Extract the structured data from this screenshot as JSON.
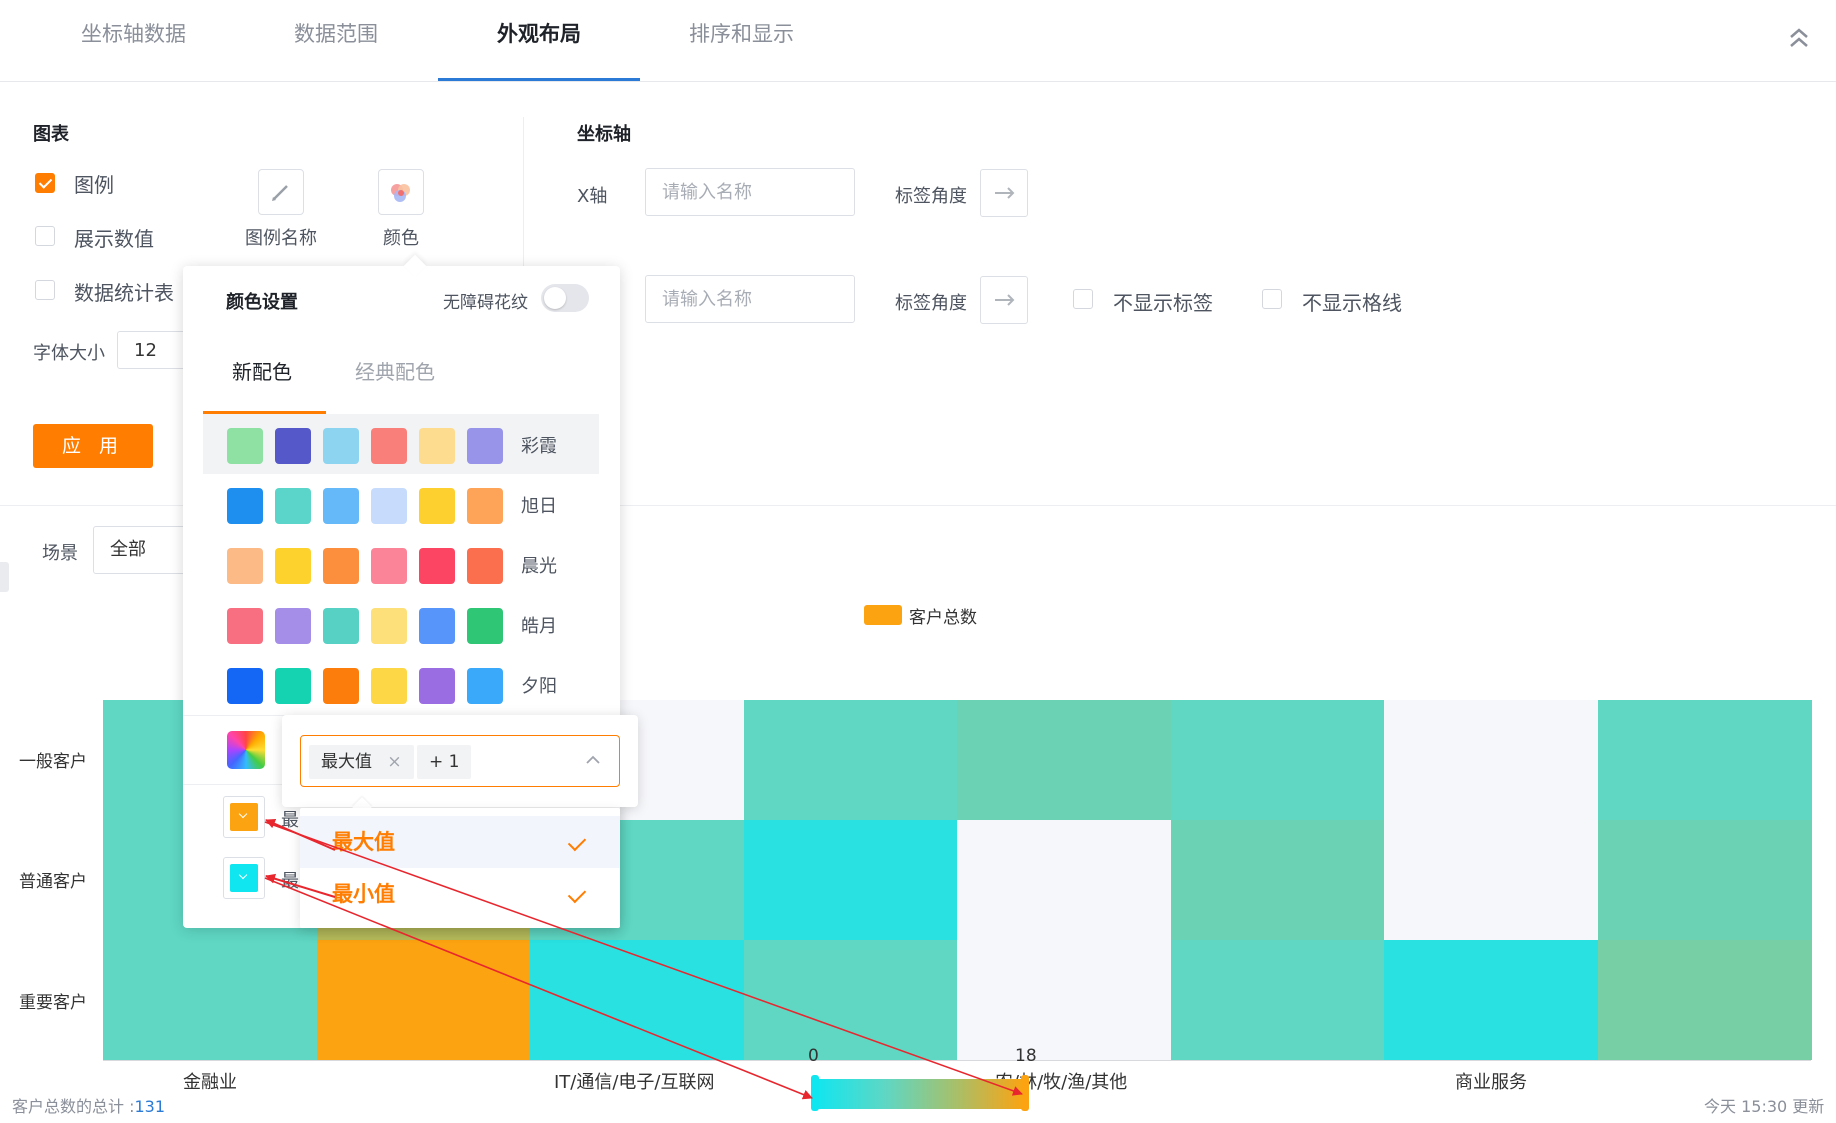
{
  "tabs": [
    {
      "label": "坐标轴数据"
    },
    {
      "label": "数据范围"
    },
    {
      "label": "外观布局"
    },
    {
      "label": "排序和显示"
    }
  ],
  "chart_settings": {
    "title": "图表",
    "legend_label": "图例",
    "show_values_label": "展示数值",
    "stats_table_label": "数据统计表",
    "legend_name_label": "图例名称",
    "color_label": "颜色",
    "font_size_label": "字体大小",
    "font_size_value": "12",
    "apply_label": "应 用"
  },
  "axis_settings": {
    "title": "坐标轴",
    "x_axis_label": "X轴",
    "name_placeholder": "请输入名称",
    "label_angle": "标签角度",
    "hide_labels": "不显示标签",
    "hide_grid": "不显示格线"
  },
  "filter": {
    "scene_label": "场景",
    "scene_value": "全部"
  },
  "color_popover": {
    "title": "颜色设置",
    "accessible_label": "无障碍花纹",
    "tabs": [
      "新配色",
      "经典配色"
    ],
    "schemes": [
      {
        "name": "彩霞",
        "colors": [
          "#8ee0a3",
          "#5558c9",
          "#8cd4f0",
          "#f9807a",
          "#fddc8f",
          "#9794ea"
        ]
      },
      {
        "name": "旭日",
        "colors": [
          "#1f8fef",
          "#5bd5c9",
          "#66b9f8",
          "#c7dbfd",
          "#fdd02f",
          "#fda458"
        ]
      },
      {
        "name": "晨光",
        "colors": [
          "#fcba87",
          "#fdd22c",
          "#fb8f3d",
          "#fb8498",
          "#fb4563",
          "#fb6e4e"
        ]
      },
      {
        "name": "皓月",
        "colors": [
          "#f96f82",
          "#a58ee8",
          "#57d1c3",
          "#fde07a",
          "#5895fa",
          "#2fc676"
        ]
      },
      {
        "name": "夕阳",
        "colors": [
          "#1467f5",
          "#15d3b0",
          "#fc7d0b",
          "#fdd746",
          "#9b6de2",
          "#3aa9fa"
        ]
      }
    ],
    "min_max_prefix": "最"
  },
  "value_select": {
    "tag1": "最大值",
    "tag_more": "+ 1",
    "options": [
      {
        "label": "最大值"
      },
      {
        "label": "最小值"
      }
    ],
    "max_color": "#fca311",
    "min_color": "#10e6f0"
  },
  "chart_data": {
    "type": "heatmap",
    "legend": "客户总数",
    "y_categories": [
      "一般客户",
      "普通客户",
      "重要客户"
    ],
    "x_labels": [
      "金融业",
      "IT/通信/电子/互联网",
      "农/林/牧/渔/其他",
      "商业服务"
    ],
    "columns": 8,
    "values": [
      [
        6,
        8,
        1,
        6,
        7,
        6,
        1,
        6
      ],
      [
        6,
        13,
        6,
        2,
        1,
        7,
        1,
        7
      ],
      [
        6,
        18,
        2,
        6,
        0,
        6,
        2,
        8
      ]
    ],
    "visual_map": {
      "min": 0,
      "max": 18
    }
  },
  "footer": {
    "total_label": "客户总数的总计 :",
    "total_value": "131",
    "updated": "今天 15:30 更新"
  }
}
